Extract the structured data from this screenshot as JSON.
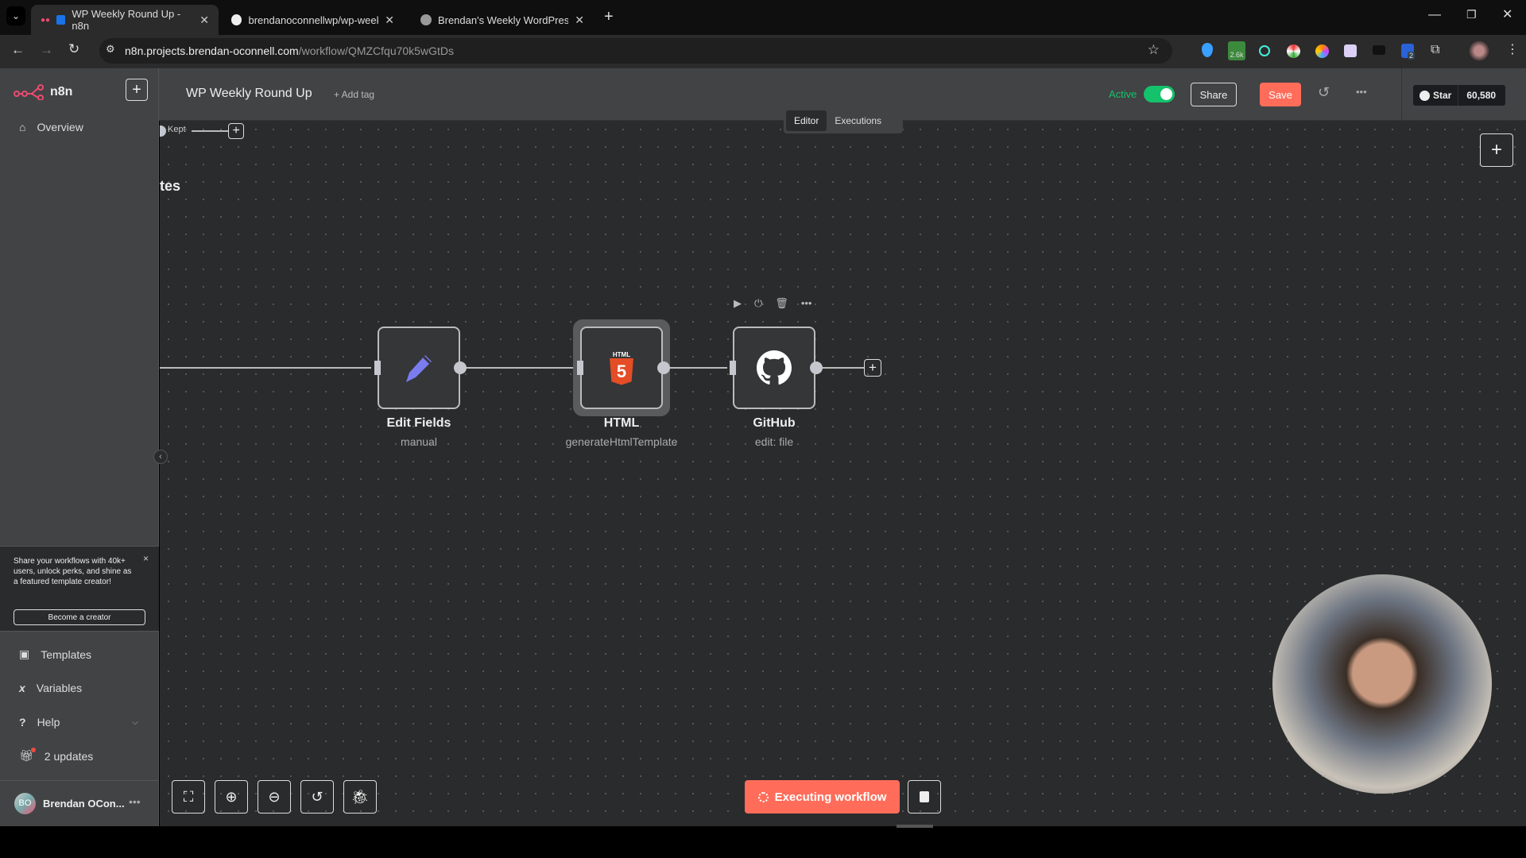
{
  "browser": {
    "tabs": [
      {
        "title": "WP Weekly Round Up - n8n",
        "active": true
      },
      {
        "title": "brendanoconnellwp/wp-weekly",
        "active": false
      },
      {
        "title": "Brendan's Weekly WordPress N",
        "active": false
      }
    ],
    "url_host": "n8n.projects.brendan-oconnell.com",
    "url_path": "/workflow/QMZCfqu70k5wGtDs",
    "extension_badges": {
      "ext2": "2.6k",
      "ext8": "2"
    }
  },
  "sidebar": {
    "brand": "n8n",
    "brand_color": "#ea4b71",
    "overview": "Overview",
    "promo": {
      "text": "Share your workflows with 40k+ users, unlock perks, and shine as a featured template creator!",
      "button": "Become a creator",
      "close": "×"
    },
    "items": [
      {
        "label": "Templates",
        "icon": "templates-icon"
      },
      {
        "label": "Variables",
        "icon": "variables-icon"
      },
      {
        "label": "Help",
        "icon": "help-icon"
      },
      {
        "label": "2 updates",
        "icon": "gift-icon"
      }
    ],
    "user": {
      "initials": "BO",
      "name": "Brendan OCon..."
    }
  },
  "header": {
    "title": "WP Weekly Round Up",
    "add_tag": "+ Add tag",
    "active_label": "Active",
    "active": true,
    "share": "Share",
    "save": "Save",
    "star": "Star",
    "star_count": "60,580",
    "accent": "#ff6d5a",
    "active_color": "#13c26b"
  },
  "canvas": {
    "tabs": [
      "Editor",
      "Executions"
    ],
    "kept_label": "Kept",
    "partial_label": "tes",
    "nodes": [
      {
        "name": "Edit Fields",
        "subtitle": "manual",
        "icon": "pencil-icon"
      },
      {
        "name": "HTML",
        "subtitle": "generateHtmlTemplate",
        "icon": "html5-icon",
        "icon_text": "HTML",
        "icon_num": "5"
      },
      {
        "name": "GitHub",
        "subtitle": "edit: file",
        "icon": "github-icon"
      }
    ],
    "executing": "Executing workflow"
  }
}
